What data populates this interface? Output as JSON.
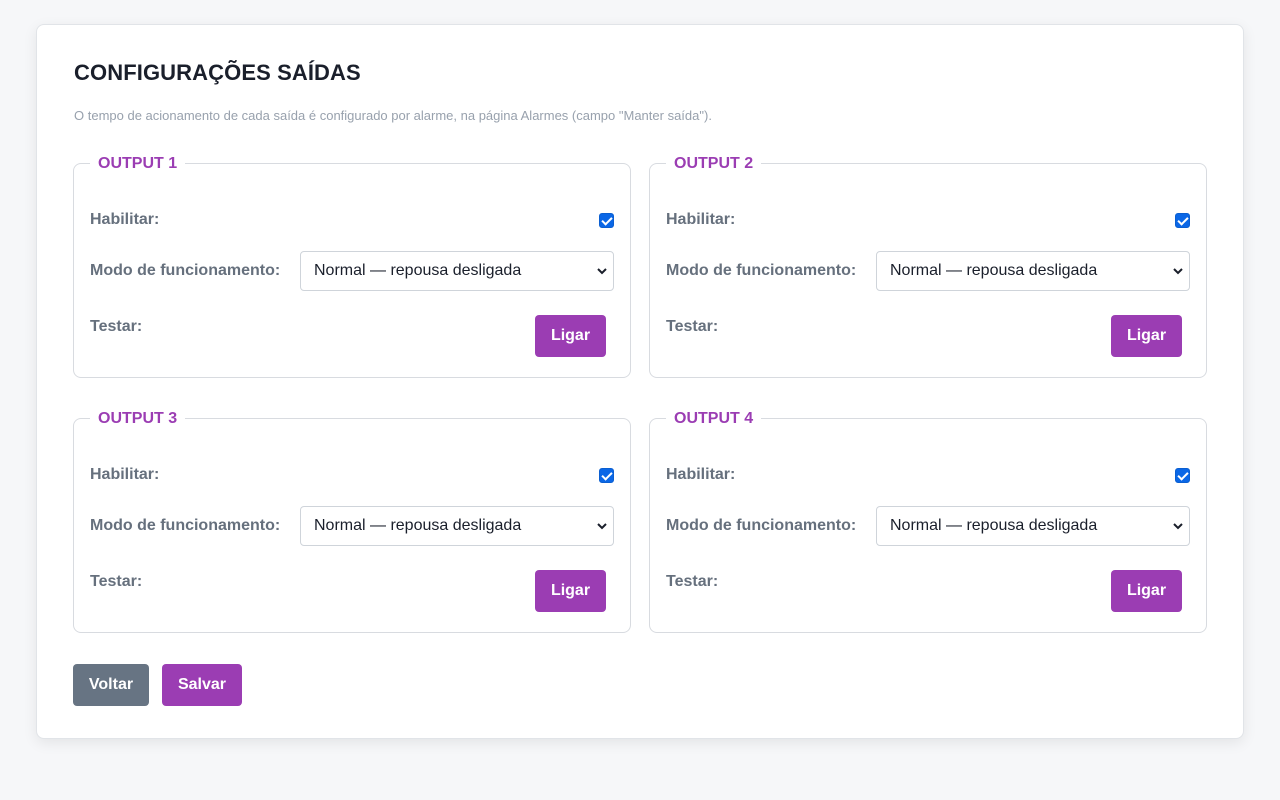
{
  "page": {
    "title": "CONFIGURAÇÕES SAÍDAS",
    "note": "O tempo de acionamento de cada saída é configurado por alarme, na página Alarmes (campo \"Manter saída\")."
  },
  "outputs": [
    {
      "legend": "OUTPUT 1",
      "enable_label": "Habilitar:",
      "enabled": true,
      "mode_label": "Modo de funcionamento:",
      "mode_value": "Normal — repousa desligada",
      "test_label": "Testar:",
      "test_button": "Ligar"
    },
    {
      "legend": "OUTPUT 2",
      "enable_label": "Habilitar:",
      "enabled": true,
      "mode_label": "Modo de funcionamento:",
      "mode_value": "Normal — repousa desligada",
      "test_label": "Testar:",
      "test_button": "Ligar"
    },
    {
      "legend": "OUTPUT 3",
      "enable_label": "Habilitar:",
      "enabled": true,
      "mode_label": "Modo de funcionamento:",
      "mode_value": "Normal — repousa desligada",
      "test_label": "Testar:",
      "test_button": "Ligar"
    },
    {
      "legend": "OUTPUT 4",
      "enable_label": "Habilitar:",
      "enabled": true,
      "mode_label": "Modo de funcionamento:",
      "mode_value": "Normal — repousa desligada",
      "test_label": "Testar:",
      "test_button": "Ligar"
    }
  ],
  "actions": {
    "back_label": "Voltar",
    "save_label": "Salvar"
  },
  "colors": {
    "accent": "#9b3db3",
    "secondary": "#677483",
    "checkbox": "#0b67e6"
  }
}
